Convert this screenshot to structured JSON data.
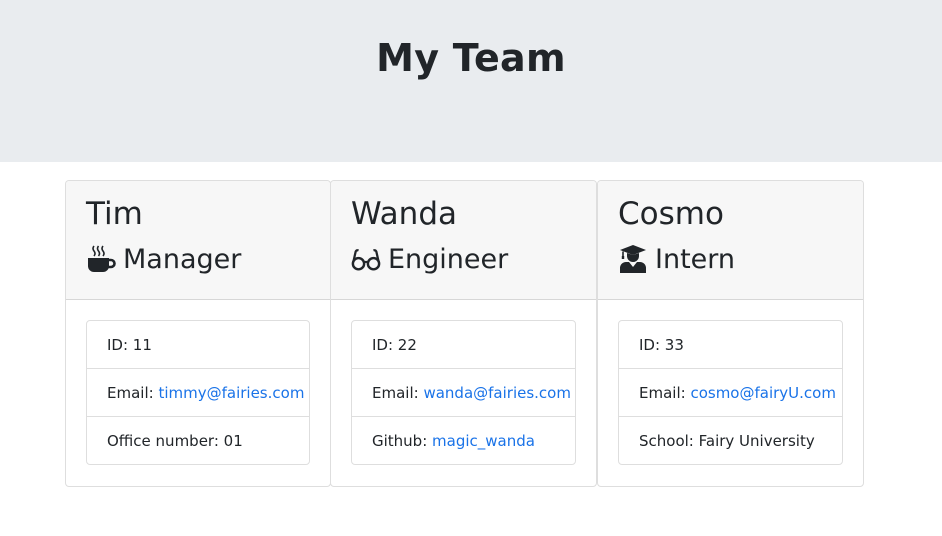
{
  "page": {
    "title": "My Team"
  },
  "colors": {
    "header_bg": "#e9ecef",
    "link": "#1a73e8",
    "card_header_bg": "#f7f7f7"
  },
  "cards": [
    {
      "name": "Tim",
      "role": "Manager",
      "icon": "coffee-mug-icon",
      "id_label": "ID: ",
      "id_value": "11",
      "email_label": "Email: ",
      "email": "timmy@fairies.com",
      "extra_label": "Office number: ",
      "extra_value": "01"
    },
    {
      "name": "Wanda",
      "role": "Engineer",
      "icon": "glasses-icon",
      "id_label": "ID: ",
      "id_value": "22",
      "email_label": "Email: ",
      "email": "wanda@fairies.com",
      "extra_label": "Github: ",
      "extra_value": "magic_wanda"
    },
    {
      "name": "Cosmo",
      "role": "Intern",
      "icon": "graduate-icon",
      "id_label": "ID: ",
      "id_value": "33",
      "email_label": "Email: ",
      "email": "cosmo@fairyU.com",
      "extra_label": "School: ",
      "extra_value": "Fairy University"
    }
  ]
}
